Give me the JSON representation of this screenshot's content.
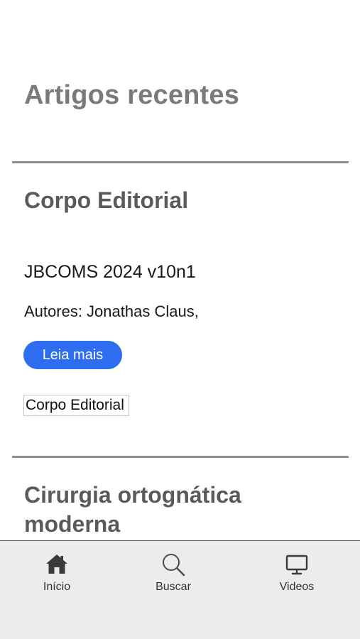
{
  "page": {
    "section_title": "Artigos recentes"
  },
  "articles": [
    {
      "title": "Corpo Editorial",
      "subtitle": "JBCOMS 2024 v10n1",
      "authors": "Autores: Jonathas Claus,",
      "read_more_label": "Leia mais",
      "tag": "Corpo Editorial"
    },
    {
      "title": "Cirurgia ortognática moderna"
    }
  ],
  "tabbar": {
    "items": [
      {
        "label": "Início",
        "icon": "home-icon"
      },
      {
        "label": "Buscar",
        "icon": "search-icon"
      },
      {
        "label": "Videos",
        "icon": "monitor-icon"
      }
    ]
  },
  "colors": {
    "accent": "#2f6df0",
    "section_title": "#7a7a7a",
    "article_title": "#5a5a5a",
    "tabbar_bg": "#ececec"
  }
}
